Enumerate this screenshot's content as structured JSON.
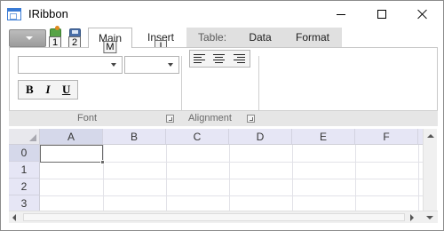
{
  "window": {
    "title": "IRibbon"
  },
  "quick_access": [
    {
      "icon": "open-icon",
      "keytip": "1"
    },
    {
      "icon": "save-icon",
      "keytip": "2"
    }
  ],
  "tabs": {
    "main": {
      "label": "Main",
      "keytip": "M"
    },
    "insert": {
      "label": "Insert",
      "keytip": "I"
    },
    "context_group": "Table:",
    "data": {
      "label": "Data"
    },
    "format": {
      "label": "Format"
    }
  },
  "ribbon": {
    "font_group_label": "Font",
    "alignment_group_label": "Alignment",
    "font_name_value": "",
    "font_size_value": "",
    "bold_label": "B",
    "italic_label": "I",
    "underline_label": "U"
  },
  "sheet": {
    "columns": [
      "A",
      "B",
      "C",
      "D",
      "E",
      "F"
    ],
    "rows": [
      "0",
      "1",
      "2",
      "3"
    ],
    "active_cell": "A0"
  },
  "colors": {
    "header_bg": "#e6e6f5",
    "context_tab_bg": "#e0e0e0"
  }
}
